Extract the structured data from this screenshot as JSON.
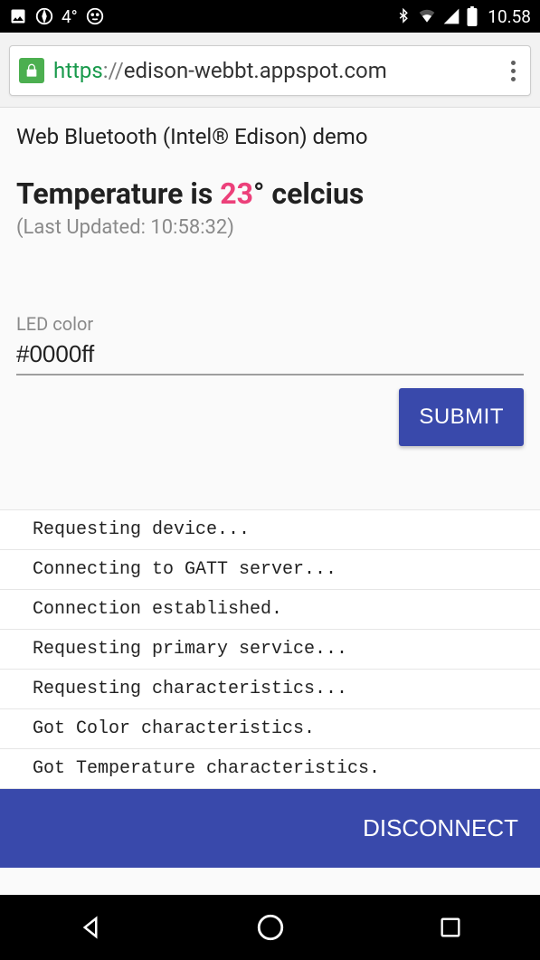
{
  "status": {
    "temperature": "4°",
    "time": "10.58"
  },
  "url": {
    "scheme": "https",
    "sep": "://",
    "host": "edison-webbt.appspot.com"
  },
  "header": {
    "title": "Web Bluetooth (Intel® Edison) demo"
  },
  "temperature": {
    "prefix": "Temperature is ",
    "value": "23",
    "suffix": "° celcius",
    "last_updated_label": "(Last Updated: ",
    "last_updated_time": "10:58:32",
    "last_updated_close": ")"
  },
  "led": {
    "label": "LED color",
    "value": "#0000ff",
    "submit_label": "SUBMIT"
  },
  "log": [
    "Requesting device...",
    "Connecting to GATT server...",
    "Connection established.",
    "Requesting primary service...",
    "Requesting characteristics...",
    "Got Color characteristics.",
    "Got Temperature characteristics."
  ],
  "footer": {
    "disconnect_label": "DISCONNECT"
  }
}
